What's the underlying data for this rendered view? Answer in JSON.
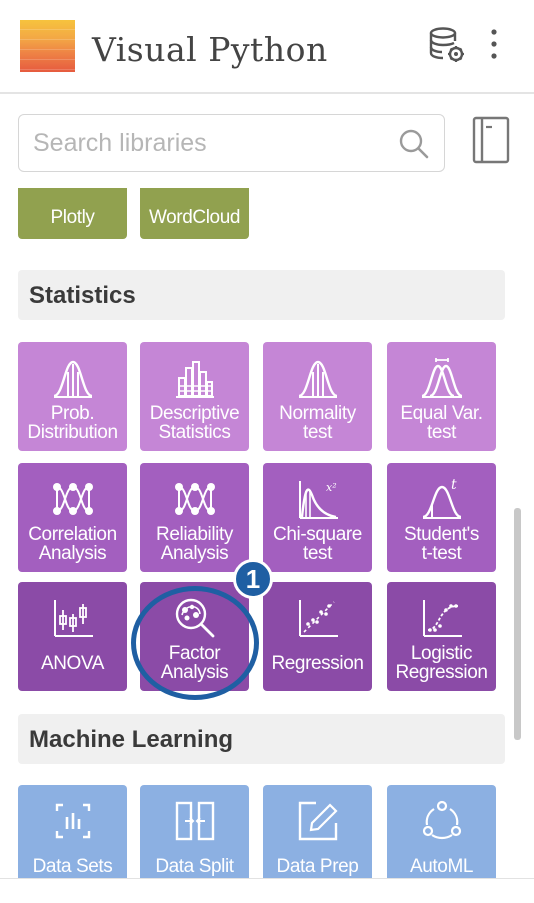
{
  "header": {
    "title": "Visual Python",
    "db_icon": "database-gear-icon",
    "menu_icon": "kebab-menu-icon"
  },
  "search": {
    "placeholder": "Search libraries",
    "value": ""
  },
  "visualization_partial": [
    {
      "label": "Plotly",
      "color": "#91a14f"
    },
    {
      "label": "WordCloud",
      "color": "#91a14f"
    }
  ],
  "statistics": {
    "title": "Statistics",
    "tiles": [
      {
        "label_1": "Prob.",
        "label_2": "Distribution",
        "icon": "bell-curve-icon",
        "color": "#c586d6"
      },
      {
        "label_1": "Descriptive",
        "label_2": "Statistics",
        "icon": "histogram-icon",
        "color": "#c586d6"
      },
      {
        "label_1": "Normality",
        "label_2": "test",
        "icon": "bell-curve-icon",
        "color": "#c586d6"
      },
      {
        "label_1": "Equal Var.",
        "label_2": "test",
        "icon": "dual-curve-icon",
        "color": "#c586d6"
      },
      {
        "label_1": "Correlation",
        "label_2": "Analysis",
        "icon": "network-icon",
        "color": "#a35fbf"
      },
      {
        "label_1": "Reliability",
        "label_2": "Analysis",
        "icon": "network-icon",
        "color": "#a35fbf"
      },
      {
        "label_1": "Chi-square",
        "label_2": "test",
        "icon": "chi-square-curve-icon",
        "color": "#a35fbf"
      },
      {
        "label_1": "Student's",
        "label_2": "t-test",
        "icon": "t-distribution-icon",
        "color": "#a35fbf"
      },
      {
        "label_1": "ANOVA",
        "label_2": "",
        "icon": "boxplot-icon",
        "color": "#8b4ba7"
      },
      {
        "label_1": "Factor",
        "label_2": "Analysis",
        "icon": "factor-analysis-icon",
        "color": "#8b4ba7"
      },
      {
        "label_1": "Regression",
        "label_2": "",
        "icon": "scatter-line-icon",
        "color": "#8b4ba7"
      },
      {
        "label_1": "Logistic",
        "label_2": "Regression",
        "icon": "logistic-curve-icon",
        "color": "#8b4ba7"
      }
    ]
  },
  "machine_learning": {
    "title": "Machine Learning",
    "tiles": [
      {
        "label": "Data Sets",
        "icon": "dataset-icon",
        "color": "#8cb0e2"
      },
      {
        "label": "Data Split",
        "icon": "split-icon",
        "color": "#8cb0e2"
      },
      {
        "label": "Data Prep",
        "icon": "edit-icon",
        "color": "#8cb0e2"
      },
      {
        "label": "AutoML",
        "icon": "cycle-icon",
        "color": "#8cb0e2"
      }
    ]
  },
  "annotation": {
    "badge": "1",
    "color": "#1f5fa3"
  }
}
